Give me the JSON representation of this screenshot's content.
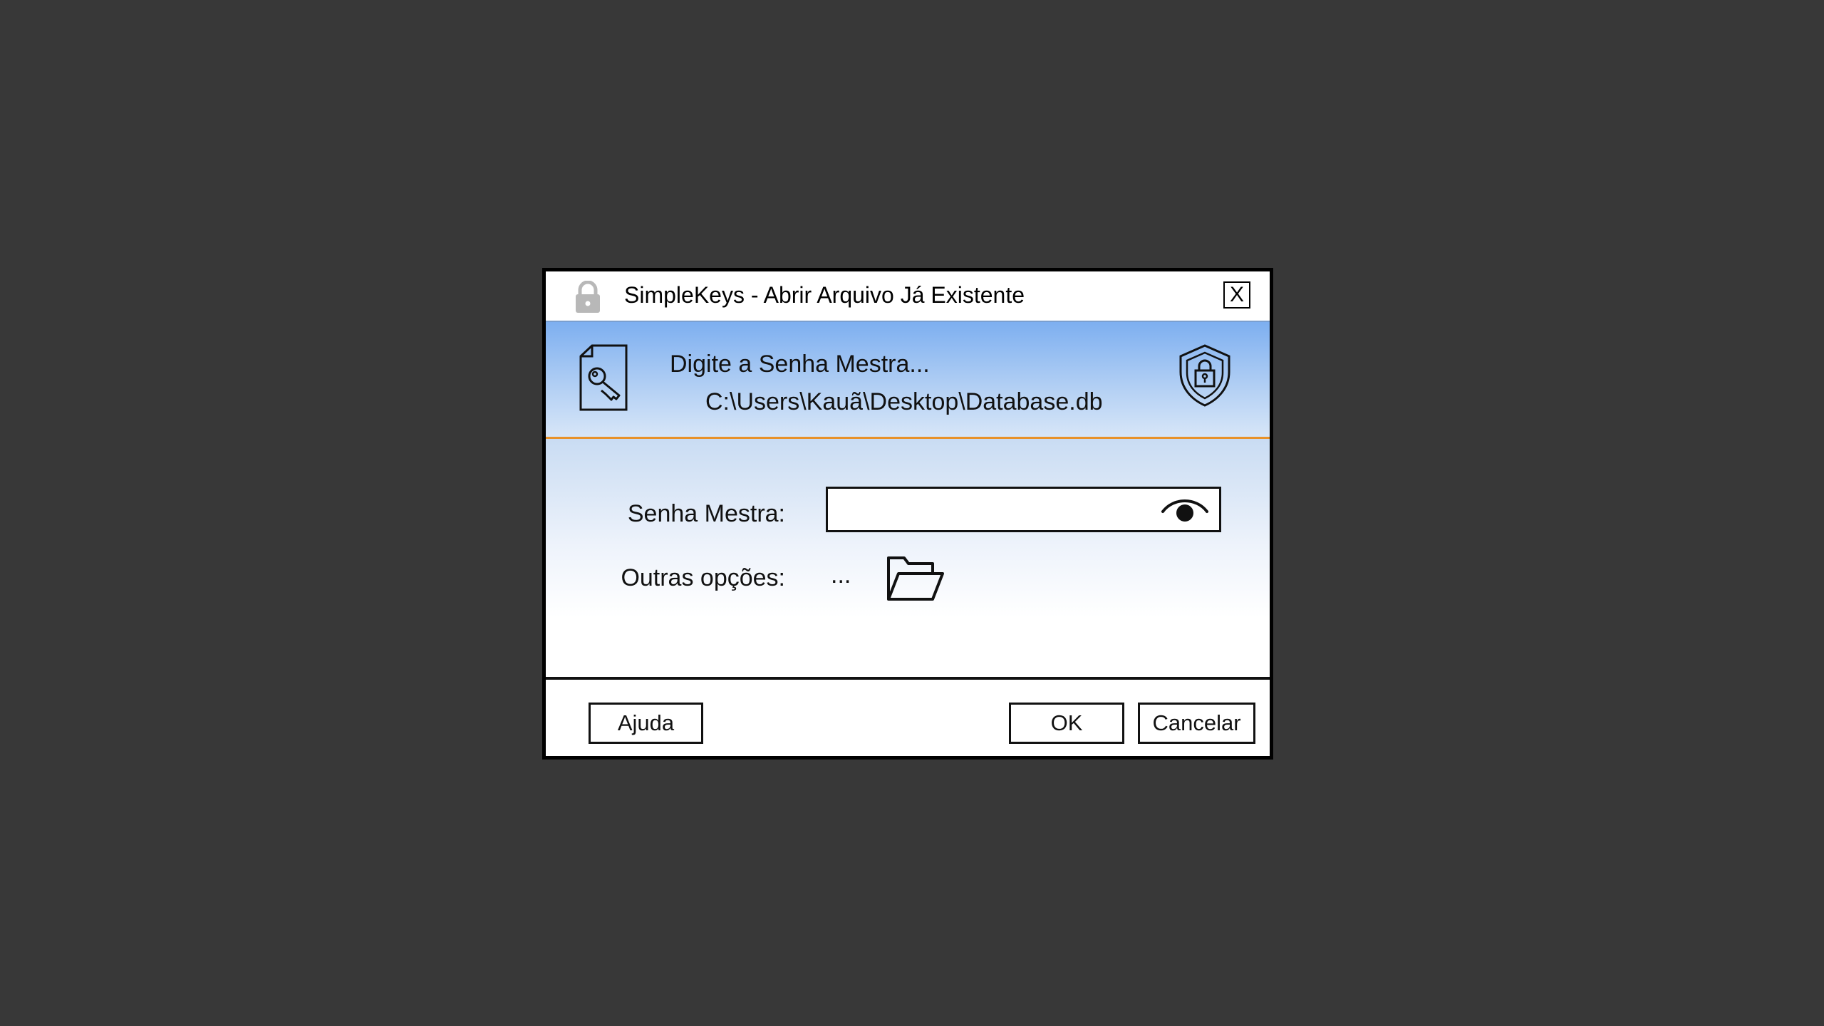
{
  "window": {
    "title": "SimpleKeys - Abrir Arquivo Já Existente",
    "close_label": "X"
  },
  "header": {
    "title": "Digite a Senha Mestra...",
    "path": "C:\\Users\\Kauã\\Desktop\\Database.db",
    "left_icon": "document-key-icon",
    "right_icon": "shield-lock-icon",
    "accent_color": "#e8922a"
  },
  "form": {
    "master_password_label": "Senha Mestra:",
    "master_password_value": "",
    "other_options_label": "Outras opções:",
    "other_options_ellipsis": "..."
  },
  "footer": {
    "help_label": "Ajuda",
    "ok_label": "OK",
    "cancel_label": "Cancelar"
  }
}
